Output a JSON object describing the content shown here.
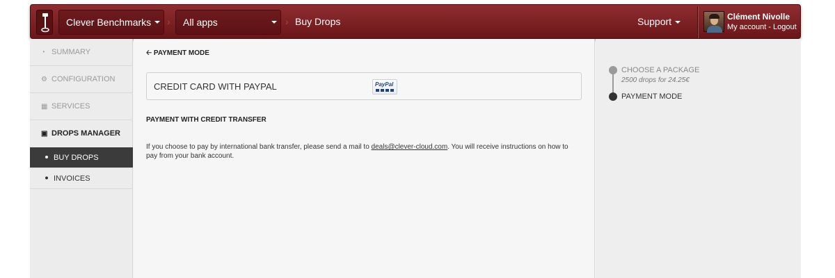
{
  "topbar": {
    "org": "Clever Benchmarks",
    "apps": "All apps",
    "page": "Buy Drops",
    "support": "Support",
    "user_name": "Clément Nivolle",
    "my_account": "My account",
    "links_sep": " - ",
    "logout": "Logout"
  },
  "sidebar": {
    "summary": "SUMMARY",
    "configuration": "CONFIGURATION",
    "services": "SERVICES",
    "drops_manager": "DROPS MANAGER",
    "buy_drops": "BUY DROPS",
    "invoices": "INVOICES"
  },
  "main": {
    "back": "PAYMENT MODE",
    "paypal_option": "CREDIT CARD WITH PAYPAL",
    "paypal_logo": "PayPal",
    "transfer_title": "PAYMENT WITH CREDIT TRANSFER",
    "transfer_text_before": "If you choose to pay by international bank transfer, please send a mail to ",
    "transfer_email": "deals@clever-cloud.com",
    "transfer_text_after": ". You will receive instructions on how to pay from your bank account."
  },
  "steps": {
    "step1": "CHOOSE A PACKAGE",
    "step1_detail": "2500 drops for 24.25€",
    "step2": "PAYMENT MODE"
  },
  "colors": {
    "brand": "#7d2023",
    "sidebar_selected": "#3b3b3b"
  }
}
